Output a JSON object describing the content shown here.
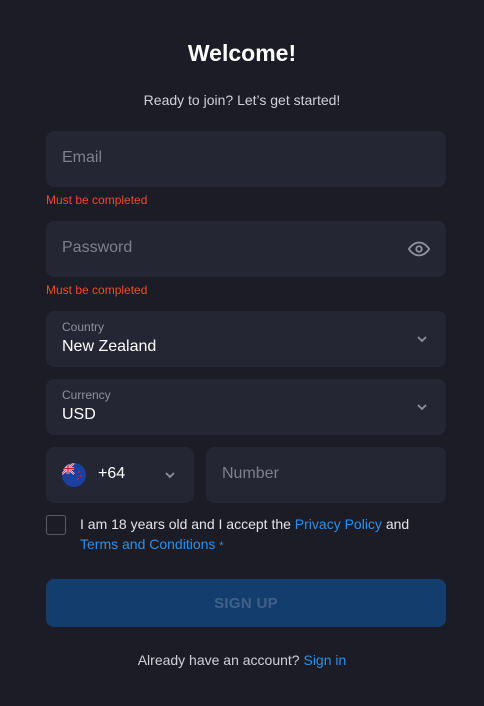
{
  "header": {
    "title": "Welcome!",
    "subtitle": "Ready to join? Let’s get started!"
  },
  "email": {
    "placeholder": "Email",
    "error": "Must be completed"
  },
  "password": {
    "placeholder": "Password",
    "error": "Must be completed",
    "toggle_icon": "eye-icon"
  },
  "country": {
    "label": "Country",
    "value": "New Zealand"
  },
  "currency": {
    "label": "Currency",
    "value": "USD"
  },
  "phone": {
    "flag_icon": "new-zealand-flag-icon",
    "code": "+64",
    "placeholder": "Number"
  },
  "terms": {
    "text_before": "I am 18 years old and I accept the ",
    "privacy_link": "Privacy Policy",
    "text_and": " and",
    "terms_link": "Terms and Conditions",
    "required_mark": "*"
  },
  "signup_button": "SIGN UP",
  "footer": {
    "prompt": "Already have an account?",
    "signin_link": "Sign in"
  },
  "colors": {
    "background": "#1b1c25",
    "field": "#252633",
    "error": "#ee4a2c",
    "link": "#2e8fe8",
    "button": "#133d6d"
  }
}
